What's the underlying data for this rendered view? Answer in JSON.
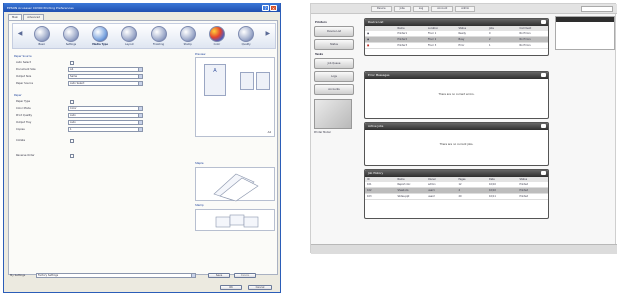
{
  "driver": {
    "title": "EPSON AcuLaser C9300 Printing Preferences",
    "tabs": [
      "Main",
      "Advanced"
    ],
    "categories": [
      {
        "label": "Basic",
        "icon": "basic-icon"
      },
      {
        "label": "Settings",
        "icon": "settings-icon"
      },
      {
        "label": "Media Type",
        "icon": "media-icon"
      },
      {
        "label": "Layout",
        "icon": "layout-icon"
      },
      {
        "label": "Finishing",
        "icon": "finishing-icon"
      },
      {
        "label": "Stamp",
        "icon": "stamp-icon"
      },
      {
        "label": "Color",
        "icon": "color-icon"
      },
      {
        "label": "Quality",
        "icon": "quality-icon"
      }
    ],
    "sections": {
      "media": "Paper Source",
      "paper": "Paper",
      "preview": "Preview",
      "output": "Output Tray",
      "finish": "Finishing"
    },
    "fields": [
      {
        "label": "Auto Select",
        "value": "",
        "kind": "check"
      },
      {
        "label": "Document Size",
        "value": "A4",
        "kind": "select"
      },
      {
        "label": "Output Size",
        "value": "Same",
        "kind": "select"
      },
      {
        "label": "Paper Source",
        "value": "Auto Select",
        "kind": "select"
      },
      {
        "label": "Paper Type",
        "value": "",
        "kind": "check"
      },
      {
        "label": "Color Mode",
        "value": "Color",
        "kind": "select"
      },
      {
        "label": "Print Quality",
        "value": "Auto",
        "kind": "select"
      },
      {
        "label": "Output Tray",
        "value": "Auto",
        "kind": "select"
      },
      {
        "label": "Copies",
        "value": "1",
        "kind": "select"
      },
      {
        "label": "Collate",
        "value": "",
        "kind": "check"
      },
      {
        "label": "Reverse Order",
        "value": "",
        "kind": "check"
      }
    ],
    "preview_caption": "A4",
    "preview_label": "Preview",
    "staple_label": "Staple",
    "stamp_label": "Stamp",
    "favorites_label": "My Settings",
    "favorites_value": "Factory Settings",
    "buttons": {
      "save": "Save",
      "delete": "Delete",
      "ok": "OK",
      "cancel": "Cancel"
    }
  },
  "console": {
    "tabs": [
      "Device",
      "Jobs",
      "Log",
      "Account",
      "Admin"
    ],
    "nav_header_1": "Printers",
    "nav_header_2": "Tasks",
    "nav_buttons": [
      "Device List",
      "Status",
      "Job Queue",
      "Logs",
      "Accounts"
    ],
    "nav_caption": "Printer Model",
    "panels": [
      {
        "title": "Device List",
        "type": "table",
        "columns": [
          "",
          "Name",
          "Location",
          "Status",
          "Jobs",
          "Comment"
        ],
        "rows": [
          [
            "",
            "Printer1",
            "Floor 1",
            "Ready",
            "0",
            "No Errors"
          ],
          [
            "",
            "Printer2",
            "Floor 2",
            "Busy",
            "2",
            "No Errors"
          ],
          [
            "",
            "Printer3",
            "Floor 3",
            "Error",
            "1",
            "No Errors"
          ]
        ]
      },
      {
        "title": "Error Messages",
        "type": "message",
        "message": "There are no current errors."
      },
      {
        "title": "Active Jobs",
        "type": "message",
        "message": "There are no current jobs."
      },
      {
        "title": "Job History",
        "type": "table",
        "columns": [
          "ID",
          "Name",
          "Owner",
          "Pages",
          "Date",
          "Status"
        ],
        "rows": [
          [
            "101",
            "Report.doc",
            "admin",
            "12",
            "10/10",
            "Printed"
          ],
          [
            "102",
            "Sheet.xls",
            "user1",
            "4",
            "10/10",
            "Printed"
          ],
          [
            "103",
            "Slides.ppt",
            "user2",
            "20",
            "10/11",
            "Printed"
          ]
        ]
      }
    ]
  }
}
